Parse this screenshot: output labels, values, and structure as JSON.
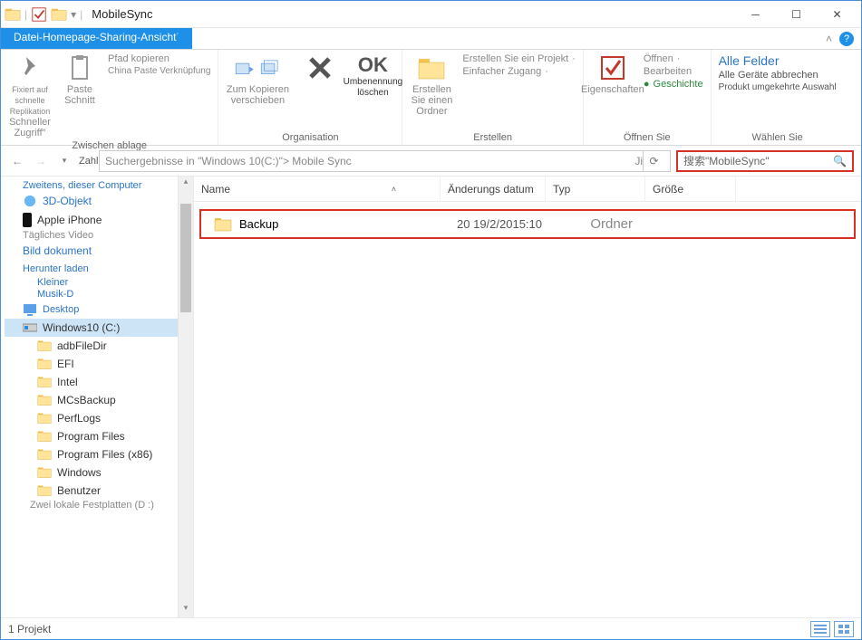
{
  "window_title": "MobileSync",
  "tabs": {
    "file": "Datei",
    "home": "Homepage",
    "share": "Sharing",
    "view": "Ansicht"
  },
  "ribbon": {
    "pin": {
      "line1": "Fixiert auf schnelle Replikation",
      "label": "Schneller Zugriff\""
    },
    "copy": "Kopieren",
    "paste": "Paste",
    "cut": "Schnitt",
    "copy_path": "Pfad kopieren",
    "paste_shortcut": "China Paste Verknüpfung",
    "clipboard_group": "Zwischen ablage",
    "move_to": "Zum Kopieren verschieben",
    "delete": "OK",
    "rename": "Umbenennung löschen",
    "org_group": "Organisation",
    "new_folder": "Erstellen Sie einen Ordner",
    "new_item": "Erstellen Sie ein Projekt",
    "easy_access": "Einfacher Zugang",
    "new_group": "Erstellen",
    "properties": "Eigenschaften",
    "open": "Öffnen",
    "edit": "Bearbeiten",
    "history": "Geschichte",
    "open_group": "Öffnen Sie",
    "select_all": "Alle Felder",
    "select_none": "Alle Geräte abbrechen",
    "invert": "Produkt umgekehrte Auswahl",
    "select_group": "Wählen Sie"
  },
  "nav": {
    "up": "Zahl",
    "breadcrumb": "Suchergebnisse in \"Windows 10(C:)\"> Mobile Sync",
    "refresh": "Ji",
    "search_placeholder": "搜索\"MobileSync\""
  },
  "columns": {
    "name": "Name",
    "date": "Änderungs datum",
    "type": "Typ",
    "size": "Größe"
  },
  "tree": {
    "this_pc": "Zweitens, dieser Computer",
    "objects3d": "3D-Objekt",
    "iphone": "Apple iPhone",
    "video": "Tägliches Video",
    "pictures": "Bild dokument",
    "downloads": "Herunter laden",
    "music_small": "Kleiner",
    "music": "Musik-D",
    "desktop": "Desktop",
    "drive_c": "Windows10 (C:)",
    "adb": "adbFileDir",
    "efi": "EFI",
    "intel": "Intel",
    "mcs": "MCsBackup",
    "perflogs": "PerfLogs",
    "pf": "Program Files",
    "pf86": "Program Files (x86)",
    "windows": "Windows",
    "users": "Benutzer",
    "drive_d": "Zwei lokale Festplatten (D :)"
  },
  "rows": [
    {
      "name": "Backup",
      "date": "20 19/2/2015:10",
      "type": "Ordner"
    }
  ],
  "status": {
    "count": "1 Projekt"
  }
}
